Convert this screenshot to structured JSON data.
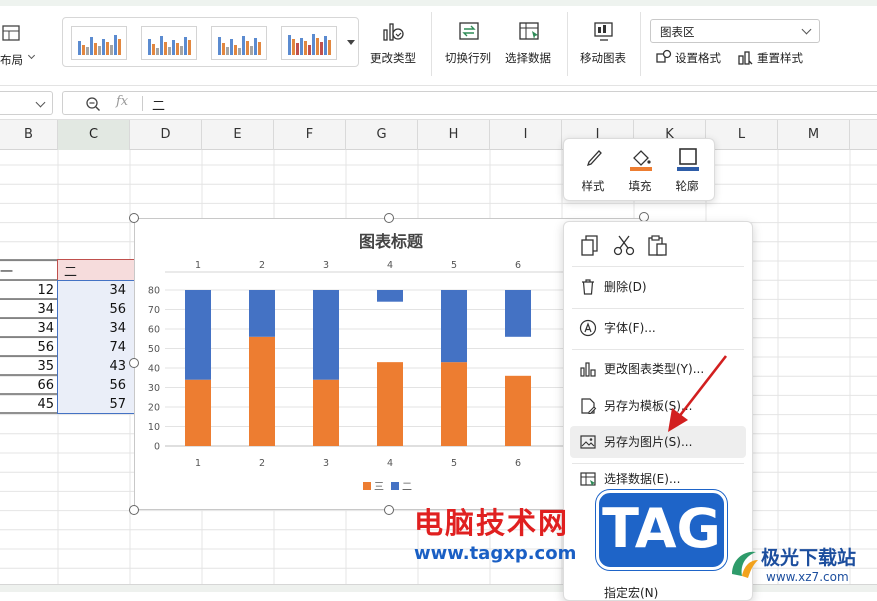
{
  "ribbon": {
    "layout_label": "布局",
    "change_type": "更改类型",
    "switch_rowcol": "切换行列",
    "select_data": "选择数据",
    "move_chart": "移动图表",
    "area_select": "图表区",
    "set_format": "设置格式",
    "reset_style": "重置样式"
  },
  "formula_bar": {
    "fx": "fx",
    "content": "二"
  },
  "columns": [
    "B",
    "C",
    "D",
    "E",
    "F",
    "G",
    "H",
    "I",
    "J",
    "K",
    "L",
    "M"
  ],
  "cells": {
    "header_b": "一",
    "header_c": "二",
    "col_b": [
      "12",
      "34",
      "34",
      "56",
      "35",
      "66",
      "45"
    ],
    "col_c": [
      "34",
      "56",
      "34",
      "74",
      "43",
      "56",
      "57"
    ]
  },
  "quick_toolbar": {
    "style": "样式",
    "fill": "填充",
    "outline": "轮廓"
  },
  "context_menu": {
    "delete": "删除(D)",
    "font": "字体(F)...",
    "change_chart_type": "更改图表类型(Y)...",
    "save_as_template": "另存为模板(S)...",
    "save_as_picture": "另存为图片(S)...",
    "select_data": "选择数据(E)...",
    "assign_macro": "指定宏(N)"
  },
  "chart_data": {
    "type": "bar",
    "title": "图表标题",
    "categories": [
      "1",
      "2",
      "3",
      "4",
      "5",
      "6"
    ],
    "series": [
      {
        "name": "三",
        "values": [
          34,
          56,
          34,
          43,
          43,
          36
        ],
        "color": "#ED7D31"
      },
      {
        "name": "二",
        "values": [
          -46,
          -24,
          -46,
          -6,
          -37,
          -24
        ],
        "color": "#4472C4"
      }
    ],
    "ylim": [
      0,
      80
    ],
    "yticks": [
      "0",
      "10",
      "20",
      "30",
      "40",
      "50",
      "60",
      "70",
      "80"
    ],
    "legend": "bottom",
    "grid": true
  },
  "watermark": {
    "site_cn": "电脑技术网",
    "site_url": "www.tagxp.com",
    "tag": "TAG",
    "brand_cn": "极光下载站",
    "brand_url": "www.xz7.com"
  }
}
